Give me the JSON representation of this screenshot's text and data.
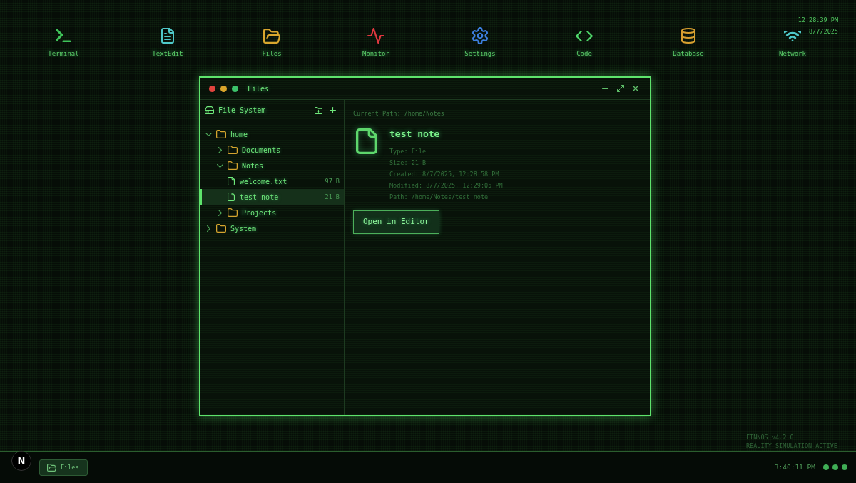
{
  "desktop_icons": [
    {
      "label": "Terminal",
      "kind": "terminal",
      "color": "#3fc45a"
    },
    {
      "label": "TextEdit",
      "kind": "text",
      "color": "#4fc9c9"
    },
    {
      "label": "Files",
      "kind": "files",
      "color": "#d9a62e"
    },
    {
      "label": "Monitor",
      "kind": "monitor",
      "color": "#e0383f"
    },
    {
      "label": "Settings",
      "kind": "settings",
      "color": "#3d7fe0"
    },
    {
      "label": "Code",
      "kind": "code",
      "color": "#4fd86a"
    },
    {
      "label": "Database",
      "kind": "database",
      "color": "#d9a030"
    },
    {
      "label": "Network",
      "kind": "network",
      "color": "#4fc9c9"
    }
  ],
  "clock": {
    "time": "12:28:39 PM",
    "date": "8/7/2025"
  },
  "window": {
    "title": "Files"
  },
  "sidebar": {
    "title": "File System",
    "tree": [
      {
        "name": "home",
        "kind": "folder",
        "expanded": true,
        "selected": false,
        "children": [
          {
            "name": "Documents",
            "kind": "folder",
            "expanded": false,
            "selected": false
          },
          {
            "name": "Notes",
            "kind": "folder",
            "expanded": true,
            "selected": false,
            "children": [
              {
                "name": "welcome.txt",
                "kind": "file",
                "size": "97 B",
                "selected": false
              },
              {
                "name": "test note",
                "kind": "file",
                "size": "21 B",
                "selected": true
              }
            ]
          },
          {
            "name": "Projects",
            "kind": "folder",
            "expanded": false,
            "selected": false
          }
        ]
      },
      {
        "name": "System",
        "kind": "folder",
        "expanded": false,
        "selected": false
      }
    ]
  },
  "details": {
    "current_path": "Current Path: /home/Notes",
    "name": "test note",
    "fields": [
      "Type: File",
      "Size: 21 B",
      "Created: 8/7/2025, 12:28:58 PM",
      "Modified: 8/7/2025, 12:29:05 PM",
      "Path: /home/Notes/test note"
    ],
    "button": "Open in Editor"
  },
  "system_info": [
    "FINNOS v4.2.0",
    "REALITY SIMULATION ACTIVE"
  ],
  "taskbar": {
    "logo": "N",
    "apps": [
      {
        "label": "Files",
        "kind": "files"
      }
    ],
    "time": "3:40:11 PM"
  }
}
